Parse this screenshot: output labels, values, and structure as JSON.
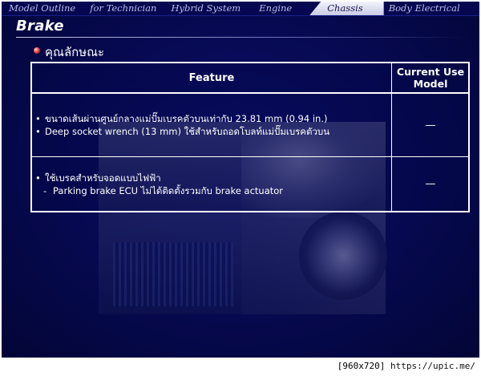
{
  "nav": {
    "items": [
      {
        "label": "Model Outline"
      },
      {
        "label": "for Technician"
      },
      {
        "label": "Hybrid System"
      },
      {
        "label": "Engine"
      },
      {
        "label": "Chassis"
      },
      {
        "label": "Body Electrical"
      }
    ],
    "active": "Chassis"
  },
  "page": {
    "title": "Brake",
    "section_title": "คุณลักษณะ"
  },
  "table": {
    "headers": {
      "feature": "Feature",
      "current": "Current Use Model"
    },
    "rows": [
      {
        "lines": [
          {
            "bullet": "•",
            "text": "ขนาดเส้นผ่านศูนย์กลางแม่ปั๊มเบรคตัวบนเท่ากับ 23.81 mm (0.94 in.)"
          },
          {
            "bullet": "•",
            "text": "Deep socket wrench (13 mm) ใช้สำหรับถอดโบลท์แม่ปั๊มเบรคตัวบน"
          }
        ],
        "current": "—"
      },
      {
        "lines": [
          {
            "bullet": "•",
            "text": "ใช้เบรคสำหรับจอดแบบไฟฟ้า"
          },
          {
            "bullet": "-",
            "text": "Parking brake ECU ไม่ได้ติดตั้งรวมกับ brake actuator"
          }
        ],
        "current": "—"
      }
    ]
  },
  "footer": {
    "size": "[960x720]",
    "url": "https://upic.me/"
  },
  "colors": {
    "background": "#06094f",
    "accent_bullet": "#e23b3b",
    "text": "#ffffff"
  }
}
